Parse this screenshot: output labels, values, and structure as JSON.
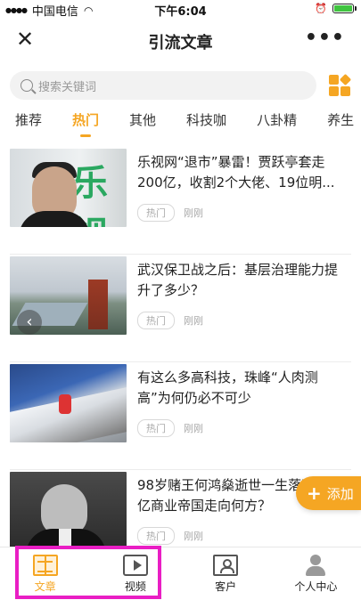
{
  "status_bar": {
    "carrier": "中国电信",
    "time": "下午6:04"
  },
  "navbar": {
    "close_label": "✕",
    "title": "引流文章",
    "more_label": "•••"
  },
  "search": {
    "placeholder": "搜索关键词"
  },
  "tabs": [
    {
      "label": "推荐",
      "active": false
    },
    {
      "label": "热门",
      "active": true
    },
    {
      "label": "其他",
      "active": false
    },
    {
      "label": "科技咖",
      "active": false
    },
    {
      "label": "八卦精",
      "active": false
    },
    {
      "label": "养生",
      "active": false
    }
  ],
  "articles": [
    {
      "title": "乐视网“退市”暴雷！贾跃亭套走200亿，收割2个大佬、19位明...",
      "tag": "热门",
      "time": "刚刚"
    },
    {
      "title": "武汉保卫战之后：基层治理能力提升了多少？",
      "tag": "热门",
      "time": "刚刚"
    },
    {
      "title": "有这么多高科技，珠峰“人肉测高”为何仍必不可少",
      "tag": "热门",
      "time": "刚刚"
    },
    {
      "title": "98岁赌王何鸿燊逝世一生落幕，千亿商业帝国走向何方？",
      "tag": "热门",
      "time": "刚刚"
    }
  ],
  "thumb_texts": {
    "article_0_logo": "乐视"
  },
  "fab": {
    "label": "添加",
    "plus": "+"
  },
  "tabbar": [
    {
      "label": "文章",
      "icon": "book-icon",
      "active": true
    },
    {
      "label": "视频",
      "icon": "video-icon",
      "active": false
    },
    {
      "label": "客户",
      "icon": "client-icon",
      "active": false
    },
    {
      "label": "个人中心",
      "icon": "person-icon",
      "active": false
    }
  ],
  "colors": {
    "accent": "#f5a623",
    "highlight": "#e91ec4"
  }
}
